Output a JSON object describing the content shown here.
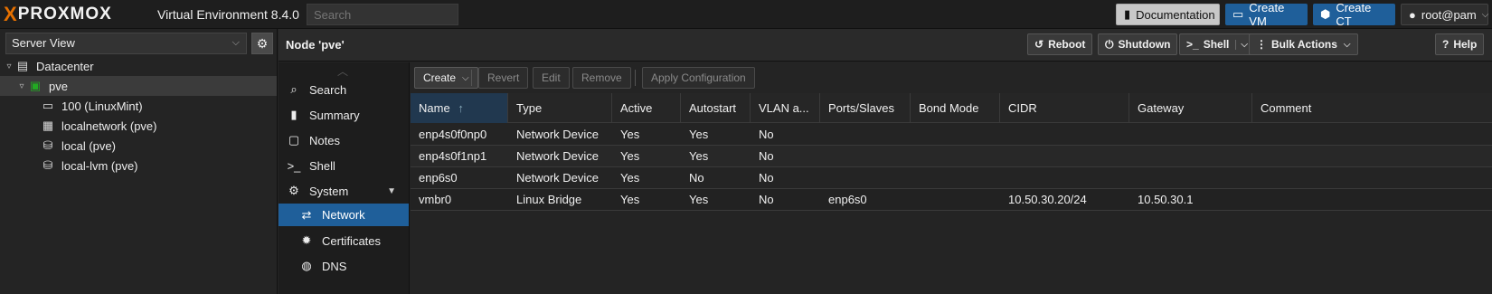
{
  "topbar": {
    "logo_x": "X",
    "logo_brand": "PROXMOX",
    "product": "Virtual Environment 8.4.0",
    "search_placeholder": "Search",
    "documentation": "Documentation",
    "create_vm": "Create VM",
    "create_ct": "Create CT",
    "user": "root@pam"
  },
  "leftpanel": {
    "view": "Server View",
    "tree": [
      {
        "label": "Datacenter",
        "icon": "datacenter-icon"
      },
      {
        "label": "pve",
        "icon": "node-online-icon"
      },
      {
        "label": "100 (LinuxMint)",
        "icon": "vm-monitor-icon"
      },
      {
        "label": "localnetwork (pve)",
        "icon": "sdn-grid-icon"
      },
      {
        "label": "local (pve)",
        "icon": "storage-icon"
      },
      {
        "label": "local-lvm (pve)",
        "icon": "storage-icon"
      }
    ]
  },
  "header": {
    "title": "Node 'pve'",
    "reboot": "Reboot",
    "shutdown": "Shutdown",
    "shell": "Shell",
    "bulk_actions": "Bulk Actions",
    "help": "Help"
  },
  "nav": {
    "items": [
      {
        "label": "Search",
        "icon": "search-icon"
      },
      {
        "label": "Summary",
        "icon": "book-icon"
      },
      {
        "label": "Notes",
        "icon": "notes-icon"
      },
      {
        "label": "Shell",
        "icon": "terminal-icon"
      },
      {
        "label": "System",
        "icon": "cogs-icon"
      },
      {
        "label": "Network",
        "icon": "exchange-icon"
      },
      {
        "label": "Certificates",
        "icon": "certificate-icon"
      },
      {
        "label": "DNS",
        "icon": "globe-icon"
      }
    ],
    "selected": "Network"
  },
  "toolbar": {
    "create": "Create",
    "revert": "Revert",
    "edit": "Edit",
    "remove": "Remove",
    "apply": "Apply Configuration"
  },
  "grid": {
    "columns": [
      "Name",
      "Type",
      "Active",
      "Autostart",
      "VLAN a...",
      "Ports/Slaves",
      "Bond Mode",
      "CIDR",
      "Gateway",
      "Comment"
    ],
    "sort_indicator": "↑",
    "rows": [
      [
        "enp4s0f0np0",
        "Network Device",
        "Yes",
        "Yes",
        "No",
        "",
        "",
        "",
        "",
        ""
      ],
      [
        "enp4s0f1np1",
        "Network Device",
        "Yes",
        "Yes",
        "No",
        "",
        "",
        "",
        "",
        ""
      ],
      [
        "enp6s0",
        "Network Device",
        "Yes",
        "No",
        "No",
        "",
        "",
        "",
        "",
        ""
      ],
      [
        "vmbr0",
        "Linux Bridge",
        "Yes",
        "Yes",
        "No",
        "enp6s0",
        "",
        "10.50.30.20/24",
        "10.50.30.1",
        ""
      ]
    ]
  },
  "colors": {
    "accent": "#1f5f9a",
    "logo_orange": "#e57000",
    "online_green": "#22aa22"
  }
}
